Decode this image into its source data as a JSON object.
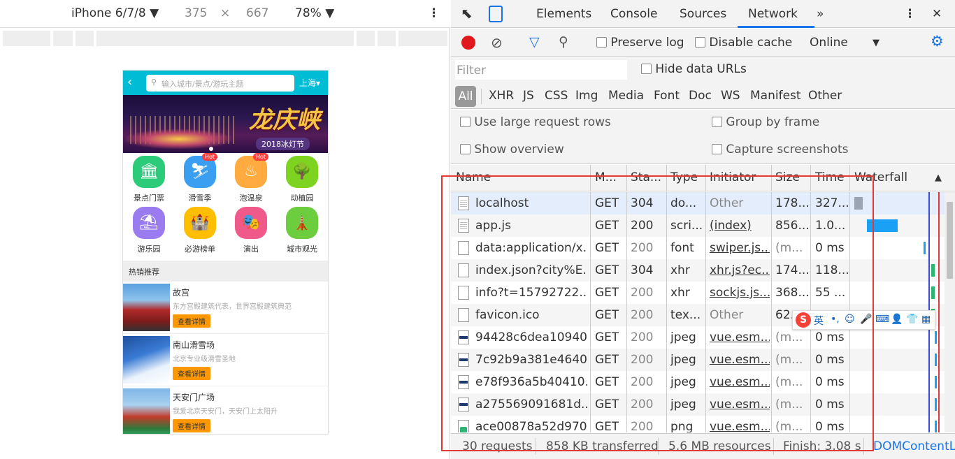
{
  "device_toolbar": {
    "device": "iPhone 6/7/8",
    "width": "375",
    "times": "×",
    "height": "667",
    "zoom": "78%"
  },
  "phone": {
    "search_placeholder": "输入城市/景点/游玩主题",
    "city": "上海",
    "banner_title": "龙庆峡",
    "banner_subtitle": "2018冰灯节",
    "categories": [
      {
        "label": "景点门票",
        "color": "#2bcb7a",
        "hot": ""
      },
      {
        "label": "滑雪季",
        "color": "#3a9ff0",
        "hot": "Hot"
      },
      {
        "label": "泡温泉",
        "color": "#ffab40",
        "hot": "Hot"
      },
      {
        "label": "动植园",
        "color": "#7ed321",
        "hot": ""
      },
      {
        "label": "游乐园",
        "color": "#9b7cf0",
        "hot": ""
      },
      {
        "label": "必游榜单",
        "color": "#ffbf00",
        "hot": ""
      },
      {
        "label": "演出",
        "color": "#f05a8a",
        "hot": ""
      },
      {
        "label": "城市观光",
        "color": "#6ccd3e",
        "hot": ""
      }
    ],
    "section_title": "热销推荐",
    "recommendations": [
      {
        "name": "故宫",
        "desc": "东方宫殿建筑代表，世界宫殿建筑典范",
        "button": "查看详情"
      },
      {
        "name": "南山滑雪场",
        "desc": "北京专业级滑雪圣地",
        "button": "查看详情"
      },
      {
        "name": "天安门广场",
        "desc": "我爱北京天安门，天安门上太阳升",
        "button": "查看详情"
      }
    ]
  },
  "devtools": {
    "tabs": [
      "Elements",
      "Console",
      "Sources",
      "Network"
    ],
    "more_tabs": "»",
    "active_tab": "Network",
    "toolbar": {
      "preserve_log": "Preserve log",
      "disable_cache": "Disable cache",
      "throttle": "Online",
      "throttle_arrow": "▼"
    },
    "filter_placeholder": "Filter",
    "hide_data_urls": "Hide data URLs",
    "types": [
      "All",
      "XHR",
      "JS",
      "CSS",
      "Img",
      "Media",
      "Font",
      "Doc",
      "WS",
      "Manifest",
      "Other"
    ],
    "options": {
      "large_rows": "Use large request rows",
      "group_by_frame": "Group by frame",
      "show_overview": "Show overview",
      "capture_screenshots": "Capture screenshots"
    },
    "columns": [
      "Name",
      "M...",
      "Sta...",
      "Type",
      "Initiator",
      "Size",
      "Time",
      "Waterfall"
    ],
    "rows": [
      {
        "name": "localhost",
        "method": "GET",
        "status": "304",
        "type": "do...",
        "initiator": "Other",
        "size": "178...",
        "time": "327...",
        "icon": "doc"
      },
      {
        "name": "app.js",
        "method": "GET",
        "status": "200",
        "type": "scri...",
        "initiator": "(index)",
        "size": "856...",
        "time": "1.0...",
        "icon": "doc"
      },
      {
        "name": "data:application/x...",
        "method": "GET",
        "status": "200",
        "type": "font",
        "initiator": "swiper.js...",
        "size": "(m...",
        "time": "0 ms",
        "icon": "blank"
      },
      {
        "name": "index.json?city%E...",
        "method": "GET",
        "status": "304",
        "type": "xhr",
        "initiator": "xhr.js?ec...",
        "size": "174...",
        "time": "118...",
        "icon": "blank"
      },
      {
        "name": "info?t=15792722...",
        "method": "GET",
        "status": "200",
        "type": "xhr",
        "initiator": "sockjs.js...",
        "size": "368...",
        "time": "55 ...",
        "icon": "blank"
      },
      {
        "name": "favicon.ico",
        "method": "GET",
        "status": "200",
        "type": "tex...",
        "initiator": "Other",
        "size": "62...",
        "time": "",
        "icon": "blank"
      },
      {
        "name": "94428c6dea10940...",
        "method": "GET",
        "status": "200",
        "type": "jpeg",
        "initiator": "vue.esm...",
        "size": "(m...",
        "time": "0 ms",
        "icon": "img"
      },
      {
        "name": "7c92b9a381e4640...",
        "method": "GET",
        "status": "200",
        "type": "jpeg",
        "initiator": "vue.esm...",
        "size": "(m...",
        "time": "0 ms",
        "icon": "img"
      },
      {
        "name": "e78f936a5b40410...",
        "method": "GET",
        "status": "200",
        "type": "jpeg",
        "initiator": "vue.esm...",
        "size": "(m...",
        "time": "0 ms",
        "icon": "img"
      },
      {
        "name": "a275569091681d...",
        "method": "GET",
        "status": "200",
        "type": "jpeg",
        "initiator": "vue.esm...",
        "size": "(m...",
        "time": "0 ms",
        "icon": "img"
      },
      {
        "name": "ace00878a52d970...",
        "method": "GET",
        "status": "200",
        "type": "png",
        "initiator": "vue.esm...",
        "size": "(m...",
        "time": "0 ms",
        "icon": "png"
      }
    ],
    "status": {
      "requests": "30 requests",
      "transferred": "858 KB transferred",
      "resources": "5.6 MB resources",
      "finish": "Finish: 3.08 s",
      "dom": "DOMContentL"
    },
    "ime_label": "英"
  }
}
